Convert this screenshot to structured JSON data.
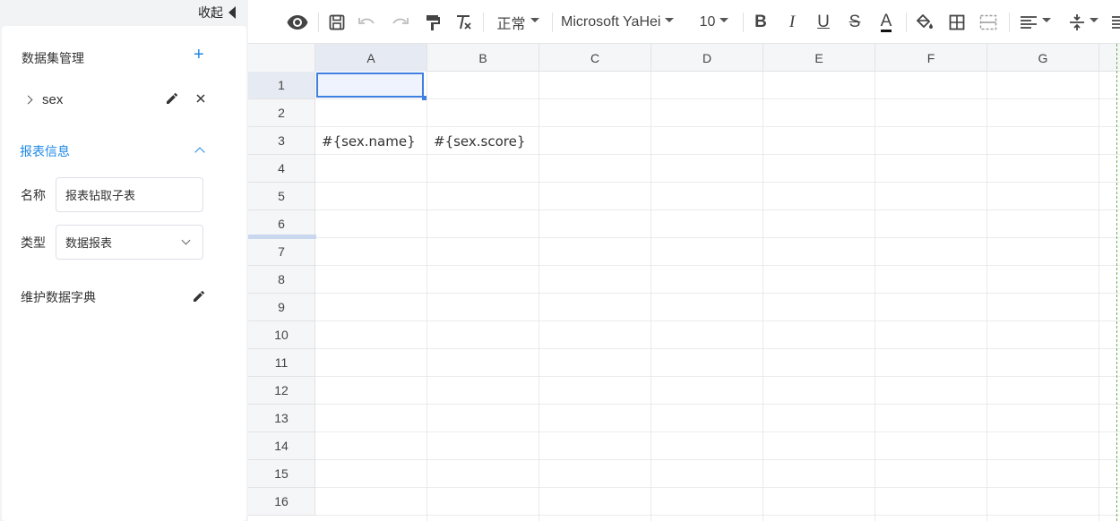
{
  "sidebar": {
    "collapse_label": "收起",
    "dataset_title": "数据集管理",
    "add_symbol": "+",
    "dataset_item": "sex",
    "section_title": "报表信息",
    "name_label": "名称",
    "name_value": "报表钻取子表",
    "type_label": "类型",
    "type_value": "数据报表",
    "dictionary_label": "维护数据字典"
  },
  "toolbar": {
    "paragraph_style": "正常",
    "font_family": "Microsoft YaHei",
    "font_size": "10",
    "bold": "B",
    "italic": "I",
    "underline": "U",
    "strike": "S",
    "font_color": "A"
  },
  "sheet": {
    "columns": [
      "A",
      "B",
      "C",
      "D",
      "E",
      "F",
      "G"
    ],
    "rows": [
      "1",
      "2",
      "3",
      "4",
      "5",
      "6",
      "7",
      "8",
      "9",
      "10",
      "11",
      "12",
      "13",
      "14",
      "15",
      "16"
    ],
    "cells": {
      "A3": "#{sex.name}",
      "B3": "#{sex.score}"
    },
    "selected_cell": "A1"
  },
  "colors": {
    "accent": "#1e88e5",
    "selection": "#3f7fe0",
    "header_bg": "#f5f6f8"
  }
}
